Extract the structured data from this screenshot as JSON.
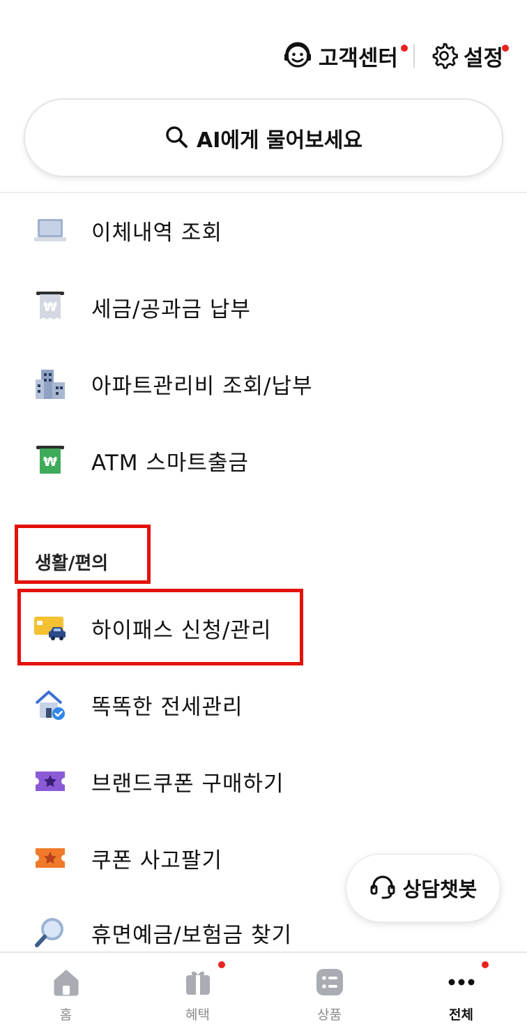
{
  "header": {
    "customer_center": "고객센터",
    "settings": "설정",
    "customer_center_icon": "smiley-headset-icon",
    "settings_icon": "gear-icon",
    "notification_color": "#e8231f"
  },
  "search": {
    "placeholder": "AI에게 물어보세요",
    "icon": "search-icon"
  },
  "menu": {
    "items": [
      {
        "label": "이체내역 조회",
        "icon": "laptop-icon"
      },
      {
        "label": "세금/공과금 납부",
        "icon": "won-receipt-icon"
      },
      {
        "label": "아파트관리비 조회/납부",
        "icon": "apartment-building-icon"
      },
      {
        "label": "ATM 스마트출금",
        "icon": "atm-won-bill-icon"
      }
    ],
    "section_title": "생활/편의",
    "life_items": [
      {
        "label": "하이패스 신청/관리",
        "icon": "hipass-card-car-icon"
      },
      {
        "label": "똑똑한 전세관리",
        "icon": "house-check-icon"
      },
      {
        "label": "브랜드쿠폰 구매하기",
        "icon": "purple-star-coupon-icon"
      },
      {
        "label": "쿠폰 사고팔기",
        "icon": "orange-star-coupon-icon"
      },
      {
        "label": "휴면예금/보험금 찾기",
        "icon": "magnifier-icon"
      }
    ]
  },
  "chatbot": {
    "label": "상담챗봇",
    "icon": "headset-icon"
  },
  "bottom_nav": {
    "items": [
      {
        "label": "홈",
        "icon": "home-icon"
      },
      {
        "label": "혜택",
        "icon": "gift-icon"
      },
      {
        "label": "상품",
        "icon": "product-list-icon"
      },
      {
        "label": "전체",
        "icon": "more-dots-icon"
      }
    ],
    "active": "전체"
  },
  "highlight_color": "#e3120b"
}
